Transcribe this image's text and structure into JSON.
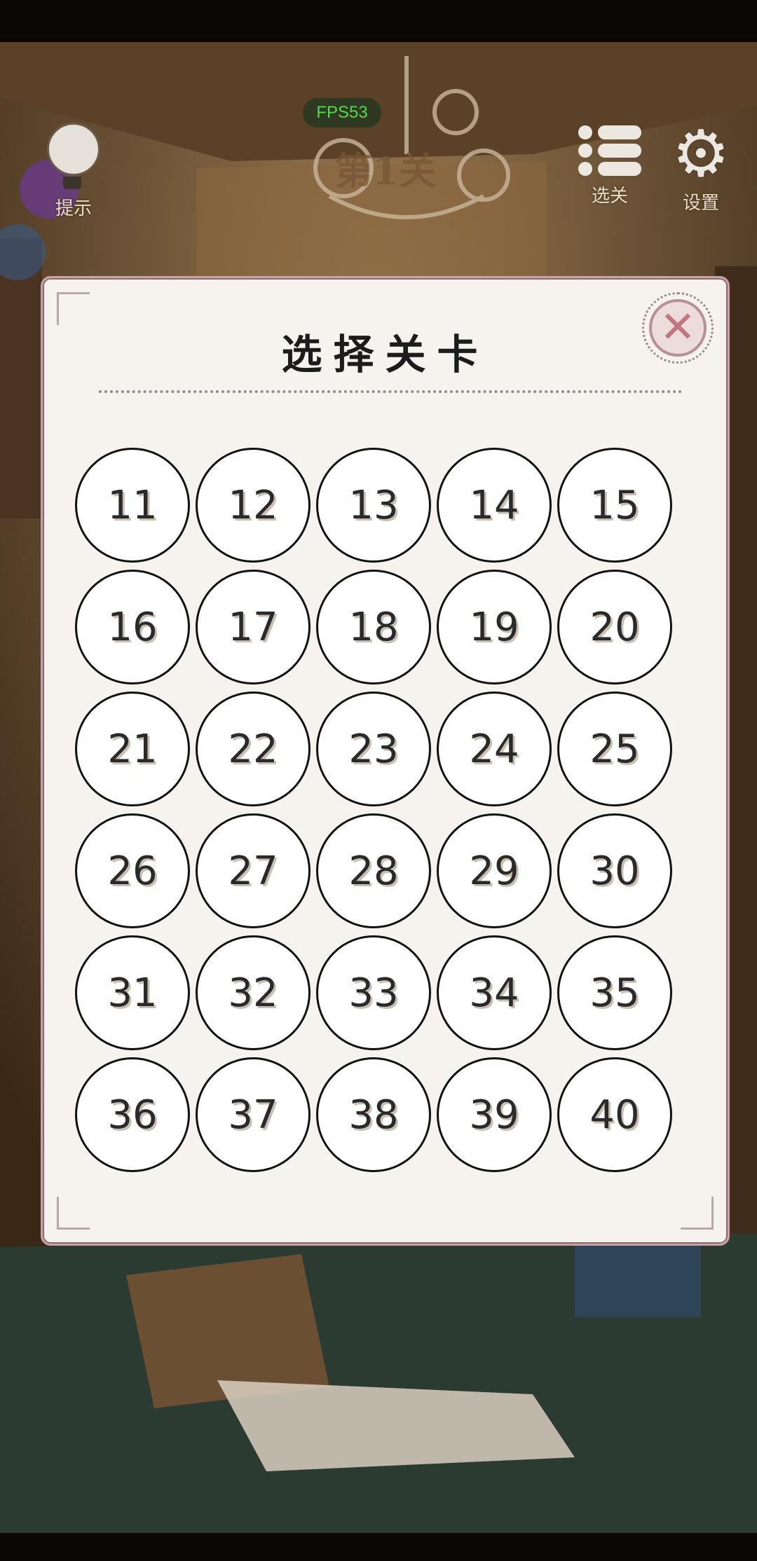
{
  "hud": {
    "fps_label": "FPS53",
    "level_title": "第1关",
    "hint_label": "提示",
    "levels_label": "选关",
    "settings_label": "设置"
  },
  "modal": {
    "title": "选择关卡",
    "close_symbol": "✕"
  },
  "levels": [
    "11",
    "12",
    "13",
    "14",
    "15",
    "16",
    "17",
    "18",
    "19",
    "20",
    "21",
    "22",
    "23",
    "24",
    "25",
    "26",
    "27",
    "28",
    "29",
    "30",
    "31",
    "32",
    "33",
    "34",
    "35",
    "36",
    "37",
    "38",
    "39",
    "40"
  ],
  "colors": {
    "modal_bg": "#f6f3ee",
    "modal_border": "#c8a2a8",
    "close_accent": "#c2767f",
    "fps_text": "#56d94a"
  }
}
